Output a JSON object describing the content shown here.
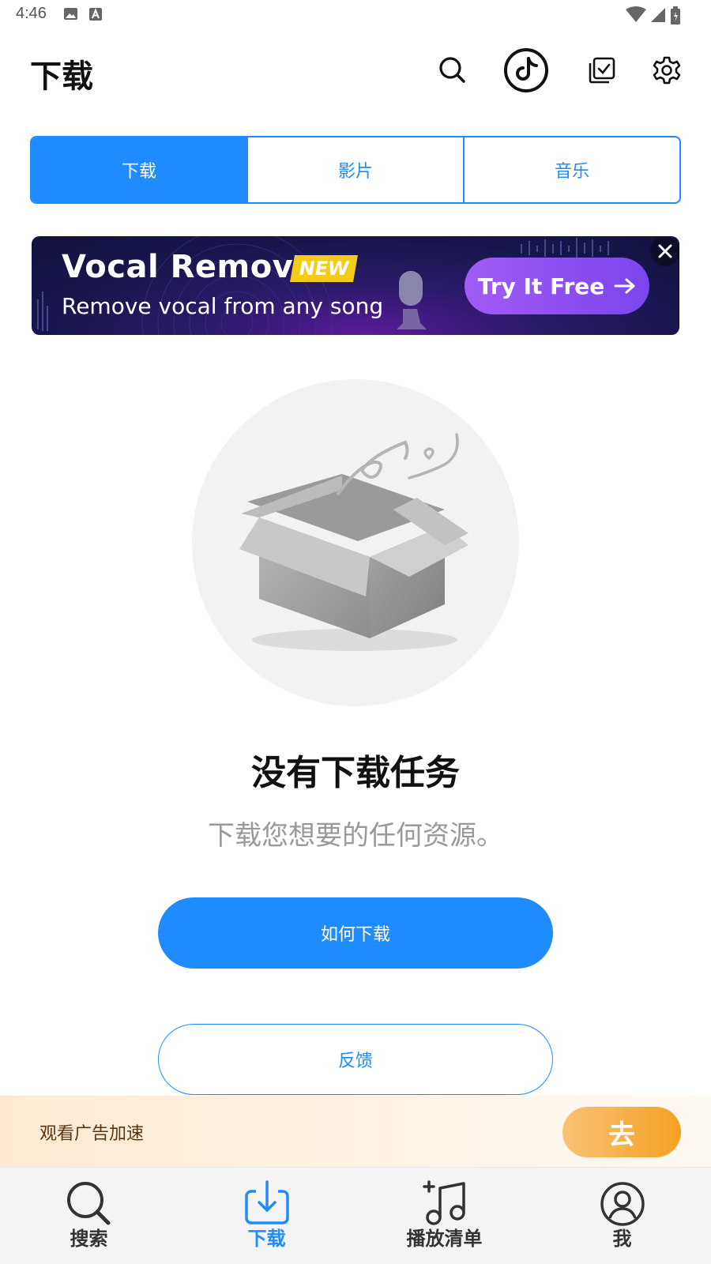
{
  "status_bar": {
    "time": "4:46"
  },
  "header": {
    "title": "下载",
    "icons": [
      "search-icon",
      "tiktok-icon",
      "multi-select-icon",
      "settings-icon"
    ]
  },
  "tabs": [
    {
      "label": "下载",
      "active": true
    },
    {
      "label": "影片",
      "active": false
    },
    {
      "label": "音乐",
      "active": false
    }
  ],
  "banner": {
    "title": "Vocal Remover",
    "badge": "NEW",
    "subtitle": "Remove vocal from any song",
    "cta": "Try It Free"
  },
  "empty_state": {
    "title": "没有下载任务",
    "subtitle": "下载您想要的任何资源。",
    "primary_button": "如何下载",
    "secondary_button": "反馈"
  },
  "ad_bar": {
    "text": "观看广告加速",
    "button": "去"
  },
  "bottom_nav": [
    {
      "label": "搜索",
      "icon": "search-icon",
      "active": false
    },
    {
      "label": "下载",
      "icon": "download-icon",
      "active": true
    },
    {
      "label": "播放清单",
      "icon": "playlist-icon",
      "active": false
    },
    {
      "label": "我",
      "icon": "profile-icon",
      "active": false
    }
  ],
  "colors": {
    "accent": "#1e8cff",
    "ad_button": "#f4a123",
    "banner_cta": "#8a4ff0"
  }
}
